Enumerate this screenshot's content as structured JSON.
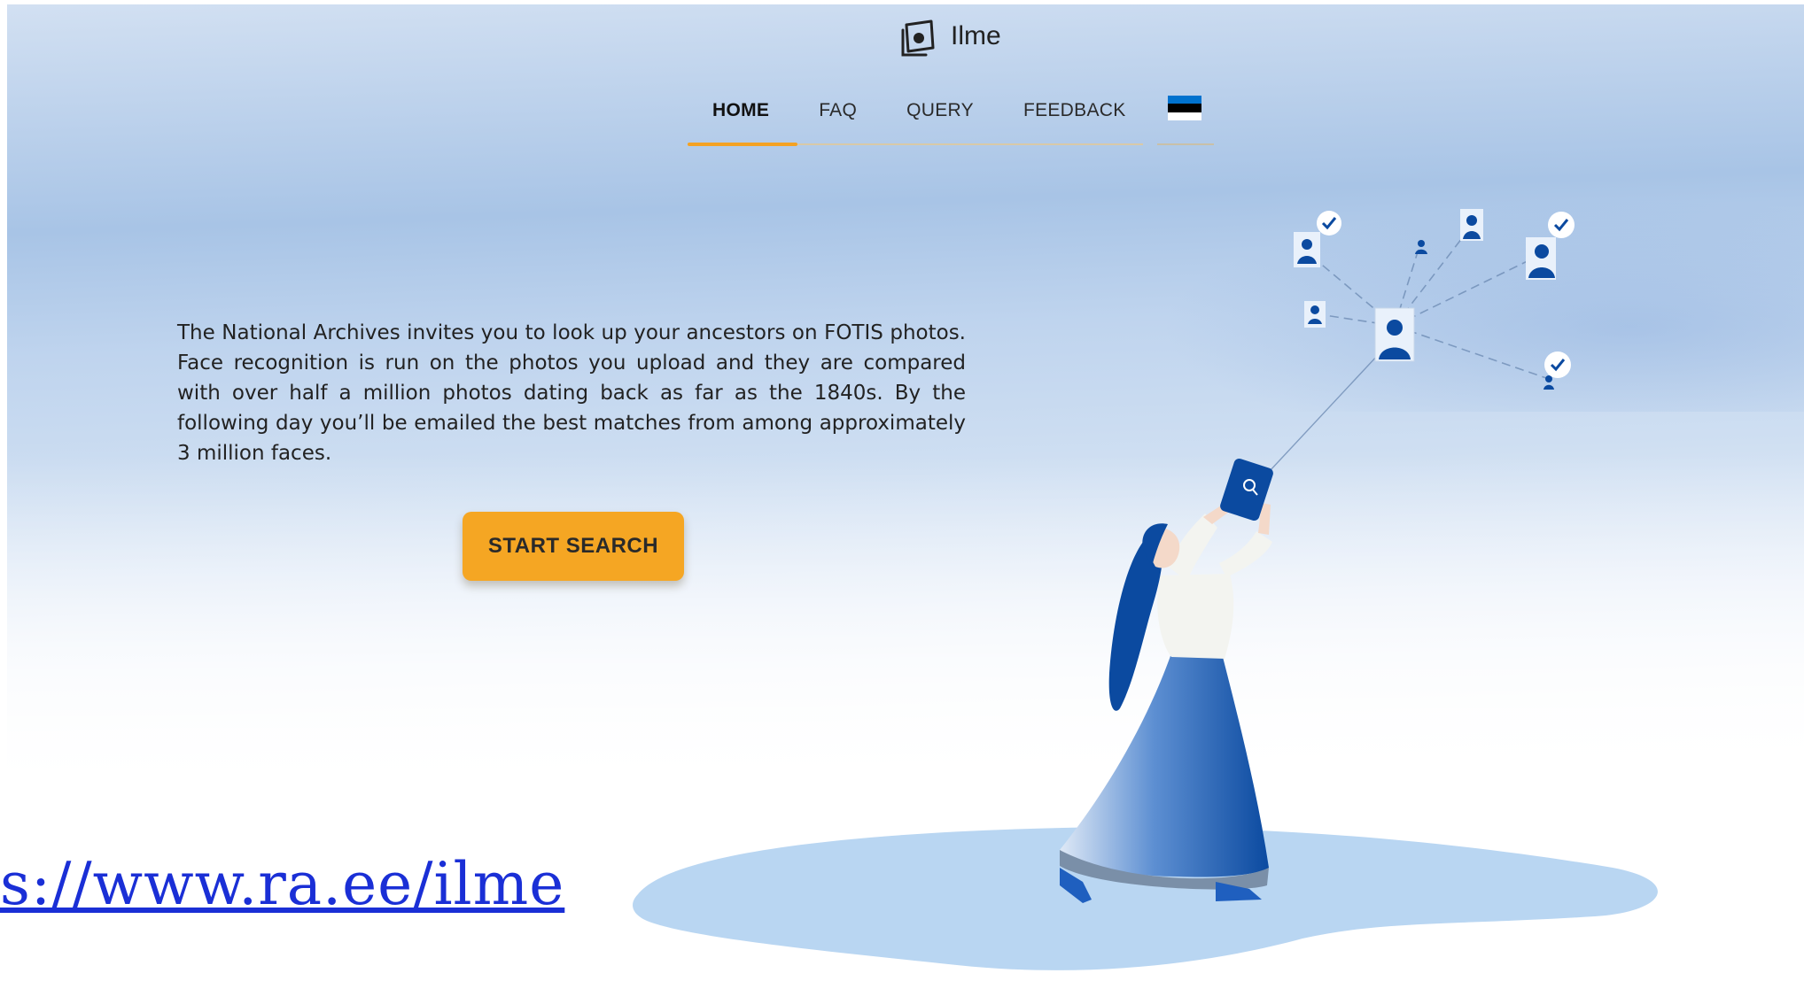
{
  "logo": {
    "name": "Ilme",
    "icon": "framed-dot-logo-icon"
  },
  "nav": {
    "items": [
      {
        "label": "HOME",
        "active": true
      },
      {
        "label": "FAQ",
        "active": false
      },
      {
        "label": "QUERY",
        "active": false
      },
      {
        "label": "FEEDBACK",
        "active": false
      }
    ],
    "language_flag": {
      "icon": "estonian-flag-icon",
      "colors": [
        "#0072CE",
        "#000000",
        "#FFFFFF"
      ]
    }
  },
  "intro_text": "The National Archives invites you to look up your ancestors on FOTIS photos. Face recognition is run on the photos you upload and they are compared with over half a million photos dating back as far as the 1840s. By the following day you’ll be emailed the best matches from among approximately 3 million faces.",
  "cta": {
    "label": "START SEARCH"
  },
  "overlay_link": {
    "text": "s://www.ra.ee/ilme"
  },
  "colors": {
    "accent": "#f5a623",
    "brand_blue": "#0b4aa0",
    "link": "#1a2fd6"
  }
}
